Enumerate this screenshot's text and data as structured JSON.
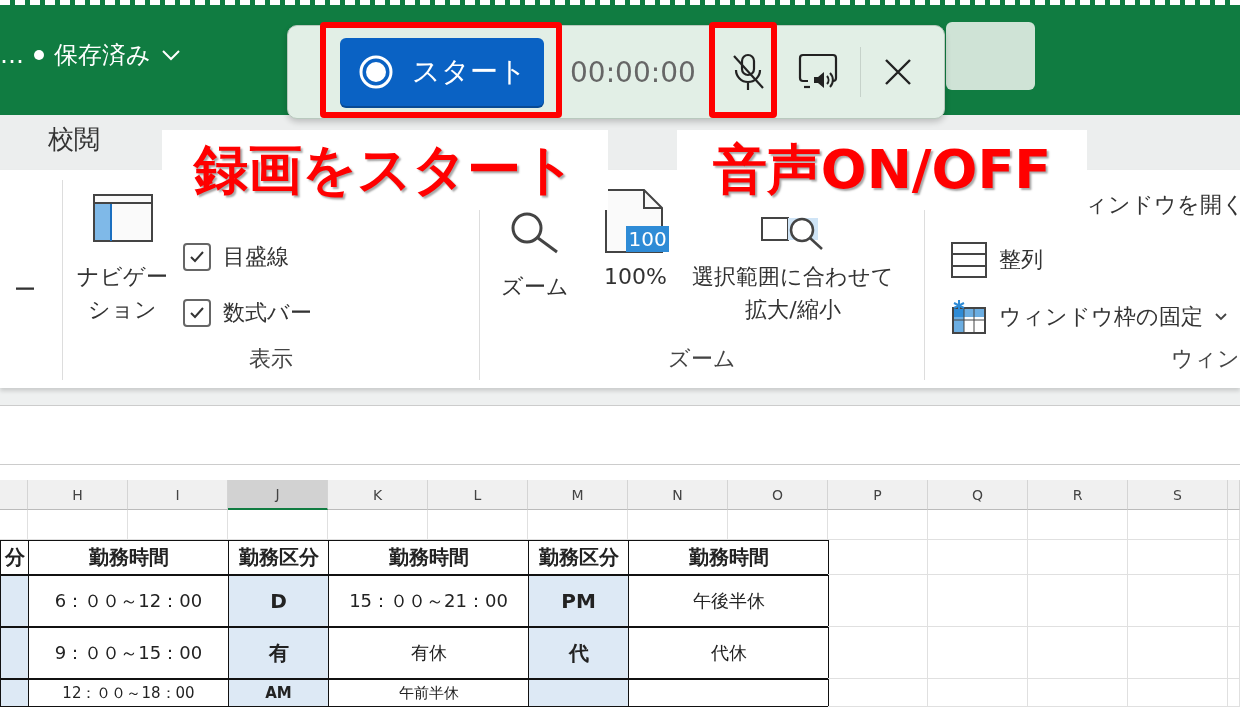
{
  "title_bar": {
    "file_name": "…",
    "status": "保存済み"
  },
  "recorder": {
    "start_label": "スタート",
    "timer": "00:00:00",
    "mic_muted": true
  },
  "callouts": [
    {
      "text": "録画をスタート"
    },
    {
      "text": "音声ON/OFF"
    }
  ],
  "tabs": [
    {
      "label": "校閲",
      "selected": false
    }
  ],
  "ribbon": {
    "fragment": "ー",
    "view": {
      "label": "表示",
      "nav_button": [
        "ナビゲー",
        "ション"
      ],
      "checkboxes": [
        {
          "label": "目盛線",
          "checked": true
        },
        {
          "label": "数式バー",
          "checked": true
        }
      ]
    },
    "zoom": {
      "label": "ズーム",
      "zoom_button": "ズーム",
      "percent_button": {
        "badge": "100",
        "label": "100%"
      },
      "fit_button": [
        "選択範囲に合わせて",
        "拡大/縮小"
      ]
    },
    "window": {
      "label": "ウィン",
      "open_window": "ィンドウを開く",
      "arrange": "整列",
      "freeze": "ウィンドウ枠の固定"
    }
  },
  "sheet": {
    "columns": [
      {
        "label": "H",
        "selected": false
      },
      {
        "label": "I",
        "selected": false
      },
      {
        "label": "J",
        "selected": true
      },
      {
        "label": "K",
        "selected": false
      },
      {
        "label": "L",
        "selected": false
      },
      {
        "label": "M",
        "selected": false
      },
      {
        "label": "N",
        "selected": false
      },
      {
        "label": "O",
        "selected": false
      },
      {
        "label": "P",
        "selected": false
      },
      {
        "label": "Q",
        "selected": false
      },
      {
        "label": "R",
        "selected": false
      },
      {
        "label": "S",
        "selected": false
      }
    ]
  },
  "table": {
    "header": [
      "分",
      "勤務時間",
      "勤務区分",
      "勤務時間",
      "勤務区分",
      "勤務時間"
    ],
    "rows": [
      [
        "",
        "6：００～12：00",
        "D",
        "15：００～21：00",
        "PM",
        "午後半休"
      ],
      [
        "",
        "9：００～15：00",
        "有",
        "有休",
        "代",
        "代休"
      ],
      [
        "",
        "12：００～18：00",
        "AM",
        "午前半休",
        "",
        ""
      ]
    ]
  }
}
